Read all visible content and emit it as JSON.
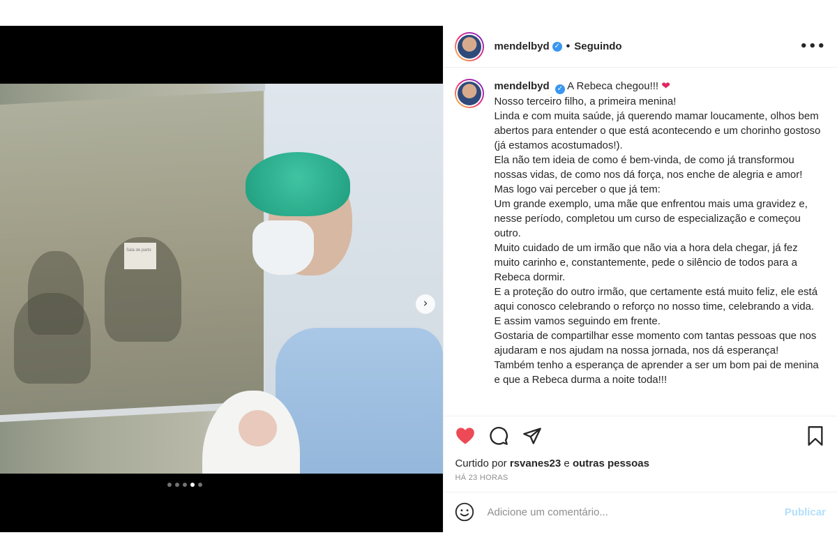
{
  "post": {
    "username": "mendelbyd",
    "follow_status": "Seguindo",
    "separator": "•",
    "more_label": "•••",
    "verified_glyph": "✓",
    "next_glyph": "›",
    "note_text": "Sala de parto",
    "carousel": {
      "total": 5,
      "active_index": 3
    }
  },
  "caption": {
    "username": "mendelbyd",
    "title": "A Rebeca chegou!!! ",
    "heart": "❤",
    "lines": [
      "Nosso terceiro filho, a primeira menina!",
      "Linda e com muita saúde, já querendo mamar loucamente, olhos bem abertos para entender o que está acontecendo e um chorinho gostoso (já estamos acostumados!).",
      "Ela não tem ideia de como é bem-vinda, de como já transformou nossas vidas, de como nos dá força, nos enche de alegria e amor!",
      "Mas logo vai perceber o que já tem:",
      "Um grande exemplo, uma mãe que enfrentou mais uma gravidez e, nesse período, completou um curso de especialização e começou outro.",
      "Muito cuidado de um irmão que não via a hora dela chegar, já fez muito carinho e, constantemente, pede o silêncio de todos para a Rebeca dormir.",
      "E a proteção do outro irmão, que certamente está muito feliz, ele está aqui conosco celebrando o reforço no nosso time, celebrando a vida.",
      "E assim vamos seguindo em frente.",
      "Gostaria de compartilhar esse momento com tantas pessoas que nos ajudaram e nos ajudam na nossa jornada, nos dá esperança!",
      "Também tenho a esperança de aprender a ser um bom pai de menina e que a Rebeca durma a noite toda!!!"
    ]
  },
  "likes": {
    "prefix": "Curtido por ",
    "user": "rsvanes23",
    "middle": " e ",
    "others": "outras pessoas"
  },
  "timestamp": "HÁ 23 HORAS",
  "comment": {
    "placeholder": "Adicione um comentário...",
    "publish_label": "Publicar"
  },
  "icons": {
    "like": "heart-filled-icon",
    "comment": "comment-icon",
    "share": "send-icon",
    "save": "bookmark-icon",
    "emoji": "emoji-icon"
  },
  "colors": {
    "like_red": "#ed4956",
    "verified_blue": "#3897f0",
    "publish_disabled": "#b2dffc",
    "muted": "#8e8e8e"
  }
}
